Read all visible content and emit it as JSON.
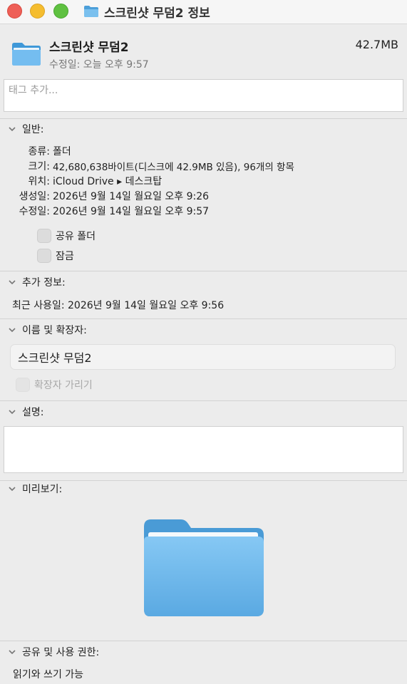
{
  "window": {
    "title": "스크린샷 무덤2 정보"
  },
  "header": {
    "name": "스크린샷 무덤2",
    "modified": "수정일: 오늘 오후 9:57",
    "size": "42.7MB",
    "icon": "folder-icon"
  },
  "tags": {
    "placeholder": "태그 추가..."
  },
  "general": {
    "title": "일반:",
    "rows": [
      {
        "label": "종류:",
        "value": "폴더"
      },
      {
        "label": "크기:",
        "value": "42,680,638바이트(디스크에 42.9MB 있음), 96개의 항목"
      },
      {
        "label": "위치:",
        "value": "iCloud Drive ▸ 데스크탑"
      },
      {
        "label": "생성일:",
        "value": "2026년 9월 14일 월요일 오후 9:26"
      },
      {
        "label": "수정일:",
        "value": "2026년 9월 14일 월요일 오후 9:57"
      }
    ],
    "shared_folder": "공유 폴더",
    "locked": "잠금"
  },
  "more_info": {
    "title": "추가 정보:",
    "last_used": "최근 사용일: 2026년 9월 14일 월요일 오후 9:56"
  },
  "name_ext": {
    "title": "이름 및 확장자:",
    "value": "스크린샷 무덤2",
    "hide_ext": "확장자 가리기"
  },
  "comments": {
    "title": "설명:"
  },
  "preview": {
    "title": "미리보기:"
  },
  "sharing": {
    "title": "공유 및 사용 권한:",
    "status": "읽기와 쓰기 가능"
  },
  "colors": {
    "close": "#ee5f57",
    "minimize": "#f5bd2f",
    "maximize": "#5fc141",
    "folder": "#6fb7ea"
  }
}
